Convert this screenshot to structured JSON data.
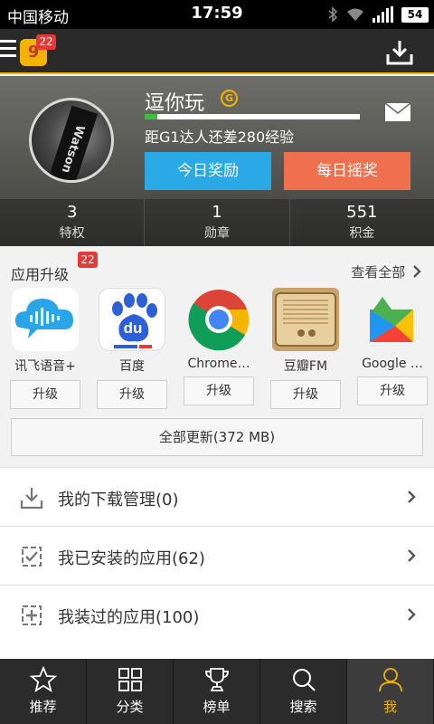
{
  "status_bar": {
    "carrier": "中国移动",
    "time": "17:59",
    "battery": "54"
  },
  "app_bar": {
    "logo_text": "9",
    "badge": "22"
  },
  "profile": {
    "username": "逗你玩",
    "level_letter": "G",
    "xp_progress": 0.06,
    "xp_text": "距G1达人还差280经验",
    "avatar_text": "Watson",
    "reward_button": "今日奖励",
    "lottery_button": "每日摇奖",
    "stats": [
      {
        "value": "3",
        "label": "特权"
      },
      {
        "value": "1",
        "label": "勋章"
      },
      {
        "value": "551",
        "label": "积金"
      }
    ]
  },
  "upgrade": {
    "title": "应用升级",
    "badge": "22",
    "view_all": "查看全部",
    "apps": [
      {
        "name": "讯飞语音+",
        "button": "升级",
        "icon": "iflytek-icon"
      },
      {
        "name": "百度",
        "button": "升级",
        "icon": "baidu-icon",
        "icon_text": "du"
      },
      {
        "name": "Chrome…",
        "button": "升级",
        "icon": "chrome-icon"
      },
      {
        "name": "豆瓣FM",
        "button": "升级",
        "icon": "douban-fm-icon"
      },
      {
        "name": "Google …",
        "button": "升级",
        "icon": "google-play-icon"
      }
    ],
    "update_all": "全部更新(372 MB)"
  },
  "list": [
    {
      "label": "我的下载管理(0)",
      "icon": "download-manage-icon"
    },
    {
      "label": "我已安装的应用(62)",
      "icon": "installed-apps-icon"
    },
    {
      "label": "我装过的应用(100)",
      "icon": "history-apps-icon"
    }
  ],
  "nav": [
    {
      "label": "推荐",
      "icon": "star-icon"
    },
    {
      "label": "分类",
      "icon": "grid-icon"
    },
    {
      "label": "榜单",
      "icon": "trophy-icon"
    },
    {
      "label": "搜索",
      "icon": "search-icon"
    },
    {
      "label": "我",
      "icon": "user-icon",
      "active": true
    }
  ],
  "colors": {
    "accent": "#f0b400",
    "reward": "#29a9e6",
    "lottery": "#f0704e",
    "badge": "#e53935",
    "xp_fill": "#3cc13c"
  }
}
